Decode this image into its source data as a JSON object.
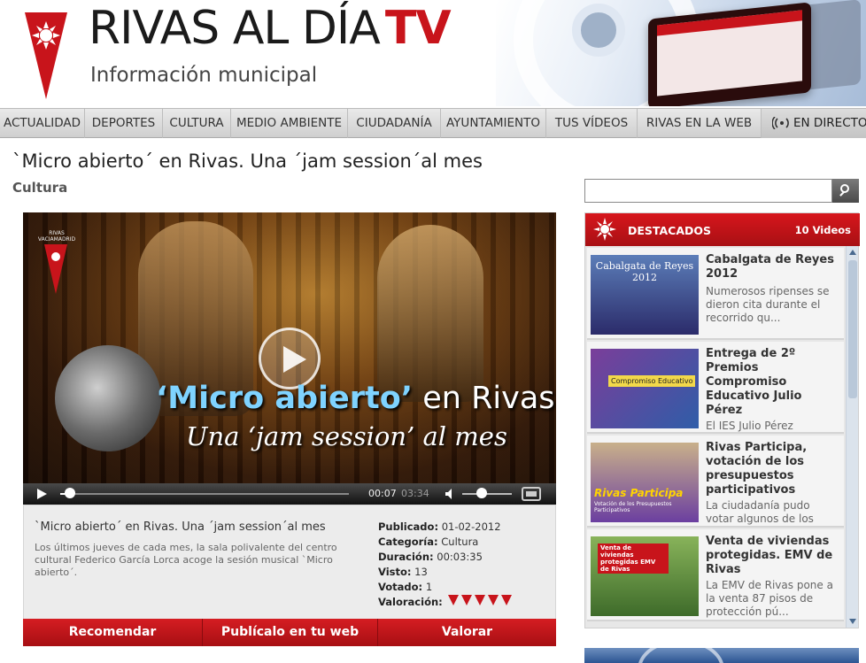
{
  "header": {
    "title": "RIVAS AL DÍA",
    "title_tv": "TV",
    "subtitle": "Información municipal"
  },
  "nav": {
    "items": [
      {
        "label": "ACTUALIDAD"
      },
      {
        "label": "DEPORTES"
      },
      {
        "label": "CULTURA"
      },
      {
        "label": "MEDIO AMBIENTE"
      },
      {
        "label": "CIUDADANÍA"
      },
      {
        "label": "AYUNTAMIENTO"
      },
      {
        "label": "TUS VÍDEOS"
      },
      {
        "label": "RIVAS EN LA WEB"
      },
      {
        "label": "EN DIRECTO",
        "icon": "broadcast-icon"
      }
    ]
  },
  "article": {
    "title": "`Micro abierto´ en Rivas. Una ´jam session´al mes",
    "category": "Cultura"
  },
  "video": {
    "logo_text": "RIVAS VACIAMADRID",
    "overlay_line1_highlight": "‘Micro abierto’",
    "overlay_line1_rest": " en Rivas",
    "overlay_line2": "Una ‘jam session’ al mes",
    "time_current": "00:07",
    "time_total": "03:34",
    "progress_fraction": 0.033,
    "volume_fraction": 0.4
  },
  "info": {
    "title": "`Micro abierto´ en Rivas. Una ´jam session´al mes",
    "description": "Los últimos jueves de cada mes, la sala polivalente del centro cultural Federico García Lorca acoge la sesión musical `Micro abierto´.",
    "published_label": "Publicado:",
    "published_value": "01-02-2012",
    "category_label": "Categoría:",
    "category_value": "Cultura",
    "duration_label": "Duración:",
    "duration_value": "00:03:35",
    "views_label": "Visto:",
    "views_value": "13",
    "votes_label": "Votado:",
    "votes_value": "1",
    "rating_label": "Valoración:",
    "rating_value": 5
  },
  "actions": {
    "recommend": "Recomendar",
    "publish": "Publícalo en tu web",
    "rate": "Valorar"
  },
  "search": {
    "placeholder": ""
  },
  "featured": {
    "title": "DESTACADOS",
    "count": "10 Videos",
    "items": [
      {
        "title": "Cabalgata de Reyes 2012",
        "desc": "Numerosos ripenses se dieron cita durante el recorrido qu...",
        "thumb_text": "Cabalgata de Reyes 2012"
      },
      {
        "title": "Entrega de 2º Premios Compromiso Educativo Julio Pérez",
        "desc": "El IES Julio Pérez",
        "thumb_text": "Compromiso Educativo"
      },
      {
        "title": "Rivas Participa, votación de los presupuestos participativos",
        "desc": "La ciudadanía pudo votar algunos de los",
        "thumb_text": "Rivas Participa",
        "thumb_sub": "Votación de los Presupuestos Participativos"
      },
      {
        "title": "Venta de viviendas protegidas. EMV de Rivas",
        "desc": "La EMV de Rivas pone a la venta 87 pisos de protección pú...",
        "thumb_text": "Venta de viviendas protegidas EMV de Rivas"
      }
    ]
  },
  "colors": {
    "brand_red": "#c8141b",
    "nav_bg": "#d9d9d9",
    "accent_blue": "#7fd3ff"
  }
}
